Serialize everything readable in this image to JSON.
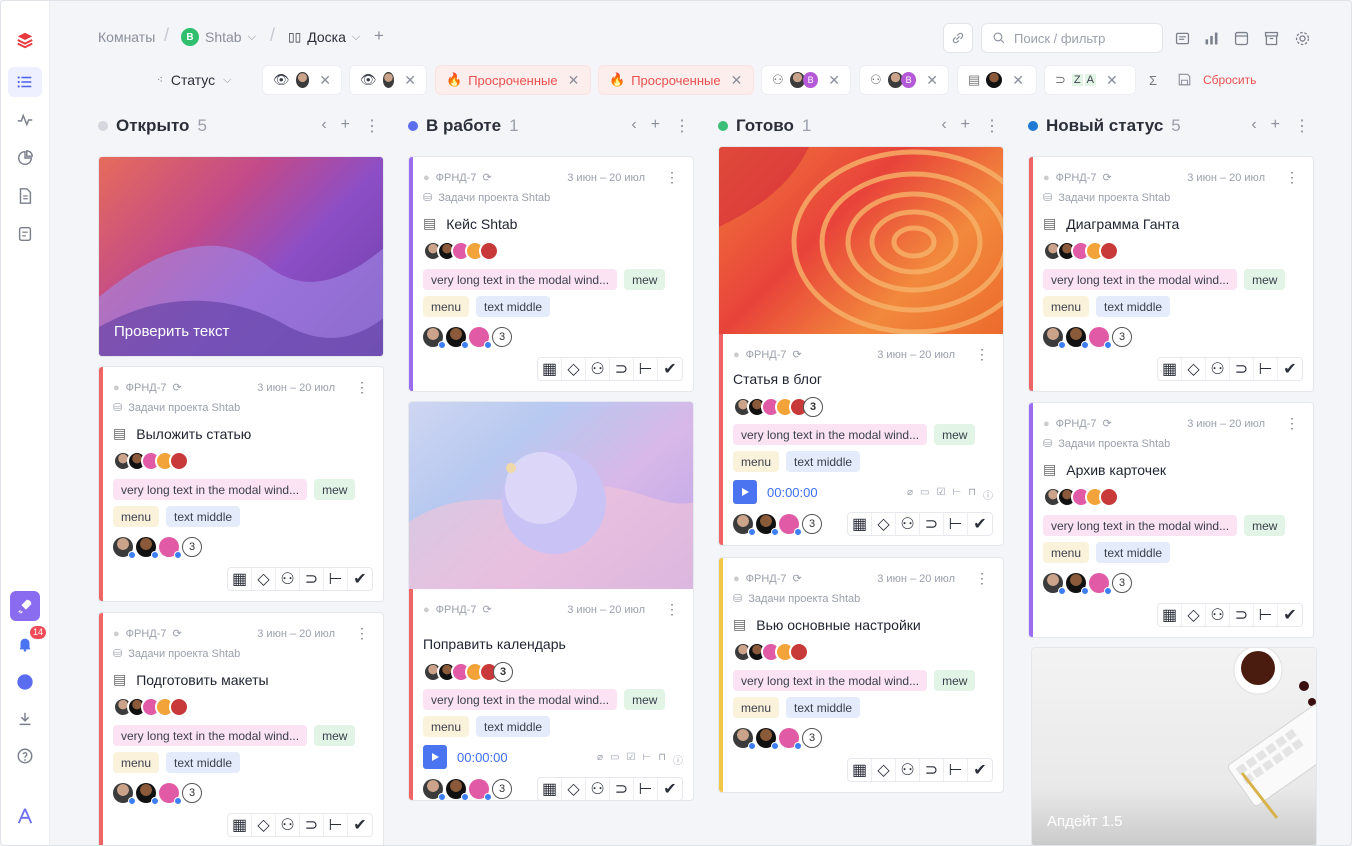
{
  "topbar": {
    "crumb_rooms": "Комнаты",
    "crumb_space": "Shtab",
    "crumb_space_initial": "B",
    "crumb_board": "Доска",
    "search_placeholder": "Поиск / фильтр",
    "reset_label": "Сбросить"
  },
  "sidebar": {
    "notif_count": "14"
  },
  "filters": {
    "status_label": "Статус",
    "overdue_1": "Просроченные",
    "overdue_2": "Просроченные",
    "chip_b1": "B",
    "chip_b2": "B",
    "chip_z": "Z",
    "chip_a": "A"
  },
  "columns": [
    {
      "name": "Открыто",
      "count": "5",
      "color": "#d4d7dd"
    },
    {
      "name": "В работе",
      "count": "1",
      "color": "#5c6ef0"
    },
    {
      "name": "Готово",
      "count": "1",
      "color": "#3bbf78"
    },
    {
      "name": "Новый статус",
      "count": "5",
      "color": "#1e7ad4"
    }
  ],
  "cards": {
    "c0": {
      "cover_title": "Проверить текст"
    },
    "c1": {
      "id": "ФРНД-7",
      "dates": "3 июн – 20 июл",
      "project": "Задачи проекта Shtab",
      "title": "Выложить статью",
      "tag1": "very long text in the modal wind...",
      "tag2": "mew",
      "tag3": "menu",
      "tag4": "text middle",
      "count": "3",
      "bar": "#ef6464"
    },
    "c2": {
      "id": "ФРНД-7",
      "dates": "3 июн – 20 июл",
      "project": "Задачи проекта Shtab",
      "title": "Подготовить макеты",
      "tag1": "very long text in the modal wind...",
      "tag2": "mew",
      "tag3": "menu",
      "tag4": "text middle",
      "count": "3",
      "bar": "#ef6464"
    },
    "c3": {
      "id": "ФРНД-7",
      "dates": "3 июн – 20 июл",
      "project": "Задачи проекта Shtab",
      "title": "Кейс Shtab",
      "tag1": "very long text in the modal wind...",
      "tag2": "mew",
      "tag3": "menu",
      "tag4": "text middle",
      "count": "3",
      "bar": "#9b6cf0"
    },
    "c4": {
      "id": "ФРНД-7",
      "dates": "3 июн – 20 июл",
      "title": "Поправить календарь",
      "tag1": "very long text in the modal wind...",
      "tag2": "mew",
      "tag3": "menu",
      "tag4": "text middle",
      "count": "3",
      "timer": "00:00:00",
      "bar": "#ef6464"
    },
    "c5": {
      "id": "ФРНД-7",
      "dates": "3 июн – 20 июл",
      "title": "Статья в блог",
      "tag1": "very long text in the modal wind...",
      "tag2": "mew",
      "tag3": "menu",
      "tag4": "text middle",
      "count": "3",
      "timer": "00:00:00",
      "bar": "#ef6464"
    },
    "c6": {
      "id": "ФРНД-7",
      "dates": "3 июн – 20 июл",
      "project": "Задачи проекта Shtab",
      "title": "Вью основные настройки",
      "tag1": "very long text in the modal wind...",
      "tag2": "mew",
      "tag3": "menu",
      "tag4": "text middle",
      "count": "3",
      "bar": "#f2c84b"
    },
    "c7": {
      "id": "ФРНД-7",
      "dates": "3 июн – 20 июл",
      "project": "Задачи проекта Shtab",
      "title": "Диаграмма Ганта",
      "tag1": "very long text in the modal wind...",
      "tag2": "mew",
      "tag3": "menu",
      "tag4": "text middle",
      "count": "3",
      "bar": "#ef6464"
    },
    "c8": {
      "id": "ФРНД-7",
      "dates": "3 июн – 20 июл",
      "project": "Задачи проекта Shtab",
      "title": "Архив карточек",
      "tag1": "very long text in the modal wind...",
      "tag2": "mew",
      "tag3": "menu",
      "tag4": "text middle",
      "count": "3",
      "bar": "#9b6cf0"
    },
    "c9": {
      "cover_title": "Апдейт 1.5"
    }
  }
}
